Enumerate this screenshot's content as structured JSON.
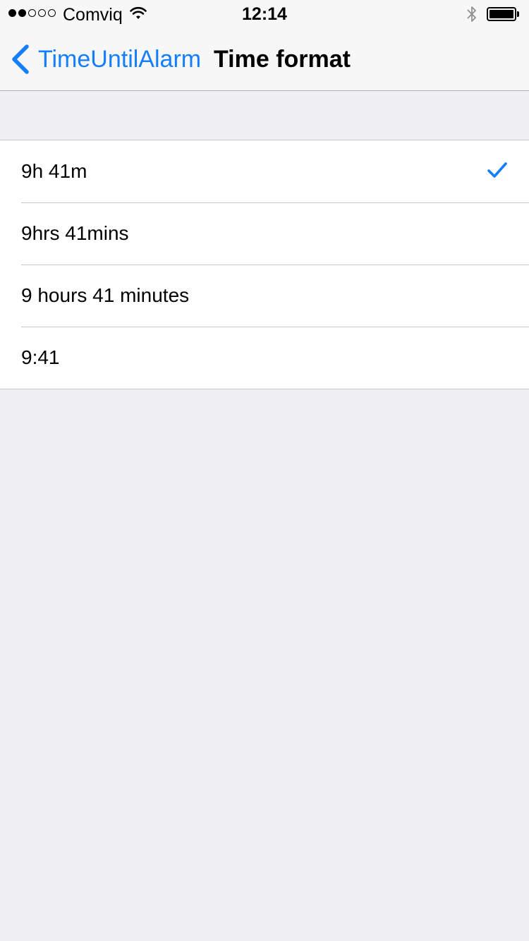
{
  "status_bar": {
    "signal_dots_filled": 2,
    "signal_dots_total": 5,
    "carrier": "Comviq",
    "time": "12:14",
    "icons": [
      "wifi-icon",
      "bluetooth-icon",
      "battery-icon"
    ],
    "battery_level": 1.0
  },
  "nav": {
    "back_label": "TimeUntilAlarm",
    "title": "Time format",
    "back_icon": "chevron-left-icon"
  },
  "options": [
    {
      "label": "9h 41m",
      "selected": true
    },
    {
      "label": "9hrs 41mins",
      "selected": false
    },
    {
      "label": "9 hours 41 minutes",
      "selected": false
    },
    {
      "label": "9:41",
      "selected": false
    }
  ],
  "colors": {
    "accent": "#147efb",
    "background": "#efeff4",
    "bar_background": "#f7f7f8",
    "separator": "#c8c7cc"
  }
}
